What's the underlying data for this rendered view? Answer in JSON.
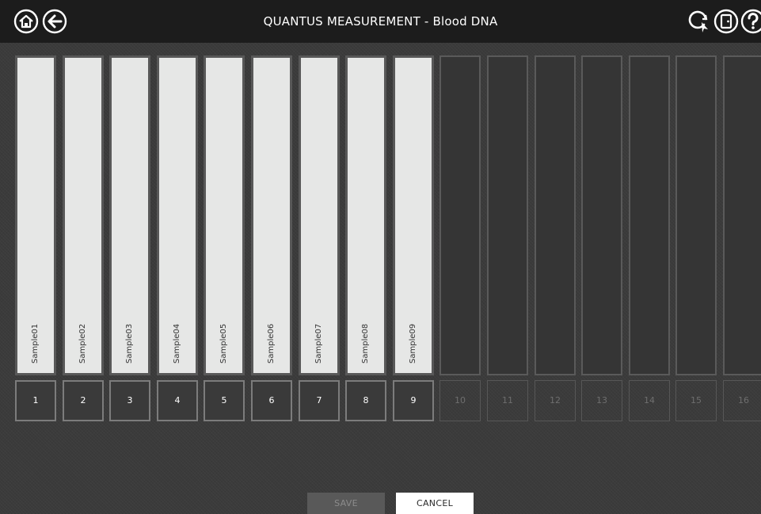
{
  "header": {
    "title": "QUANTUS MEASUREMENT - Blood DNA",
    "icons": [
      "home-icon",
      "back-arrow-icon",
      "rescan-icon",
      "exit-icon",
      "help-icon"
    ]
  },
  "slots": [
    {
      "number": "1",
      "sample": "Sample01"
    },
    {
      "number": "2",
      "sample": "Sample02"
    },
    {
      "number": "3",
      "sample": "Sample03"
    },
    {
      "number": "4",
      "sample": "Sample04"
    },
    {
      "number": "5",
      "sample": "Sample05"
    },
    {
      "number": "6",
      "sample": "Sample06"
    },
    {
      "number": "7",
      "sample": "Sample07"
    },
    {
      "number": "8",
      "sample": "Sample08"
    },
    {
      "number": "9",
      "sample": "Sample09"
    },
    {
      "number": "10",
      "sample": ""
    },
    {
      "number": "11",
      "sample": ""
    },
    {
      "number": "12",
      "sample": ""
    },
    {
      "number": "13",
      "sample": ""
    },
    {
      "number": "14",
      "sample": ""
    },
    {
      "number": "15",
      "sample": ""
    },
    {
      "number": "16",
      "sample": ""
    }
  ],
  "footer": {
    "save_label": "SAVE",
    "cancel_label": "CANCEL"
  },
  "colors": {
    "header_bg": "#1c1c1c",
    "background": "#3b3b3b",
    "filled_slot": "#e6e7e6",
    "empty_slot": "#353535"
  }
}
